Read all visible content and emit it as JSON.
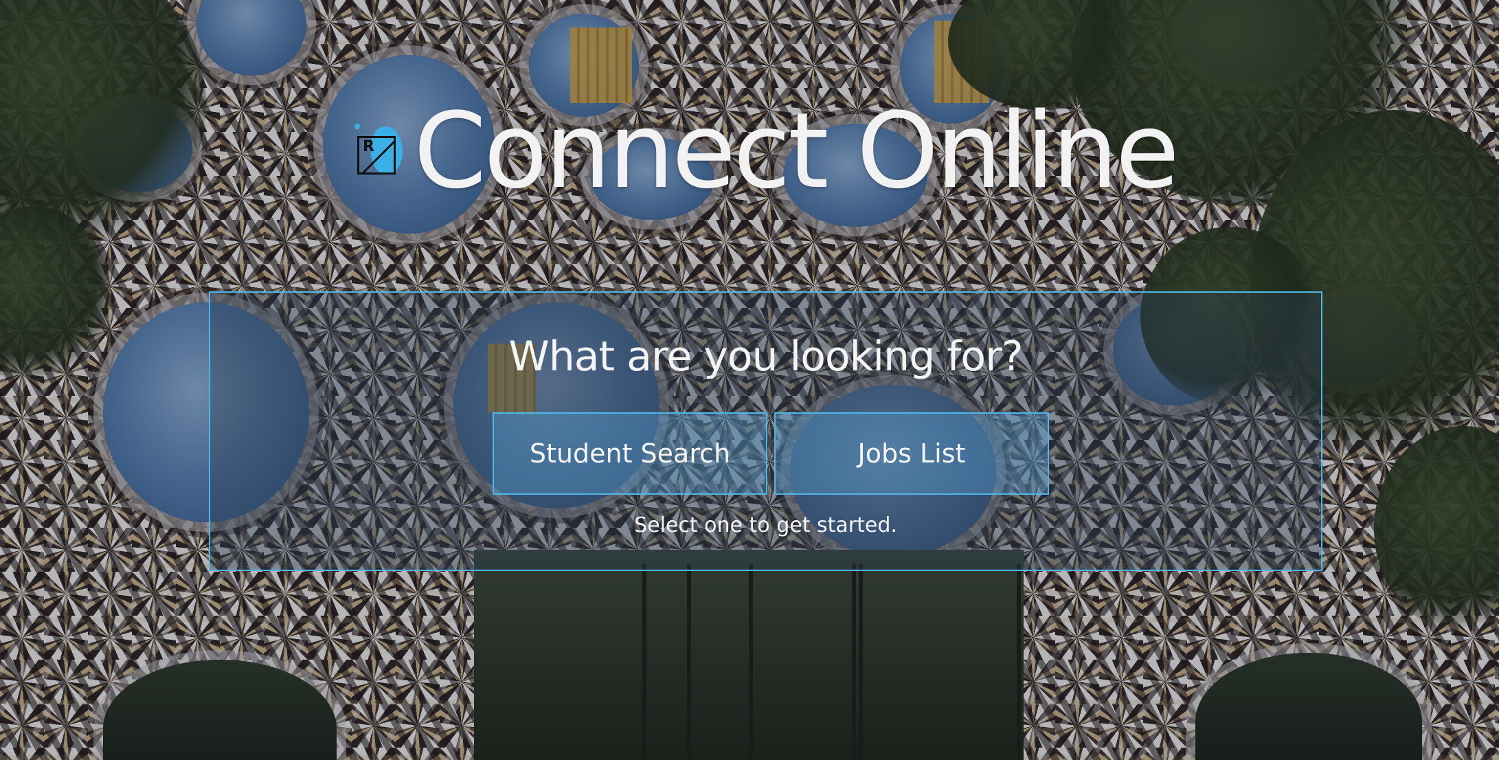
{
  "header": {
    "title": "Connect Online",
    "logo_letter": "R",
    "logo_icon": "r-logo-icon"
  },
  "panel": {
    "question": "What are you looking for?",
    "buttons": [
      {
        "label": "Student Search"
      },
      {
        "label": "Jobs List"
      }
    ],
    "hint": "Select one to get started."
  },
  "colors": {
    "accent_border": "#4fb6e8",
    "text": "#f4f4f4",
    "logo_splash": "#3cb0e6"
  }
}
